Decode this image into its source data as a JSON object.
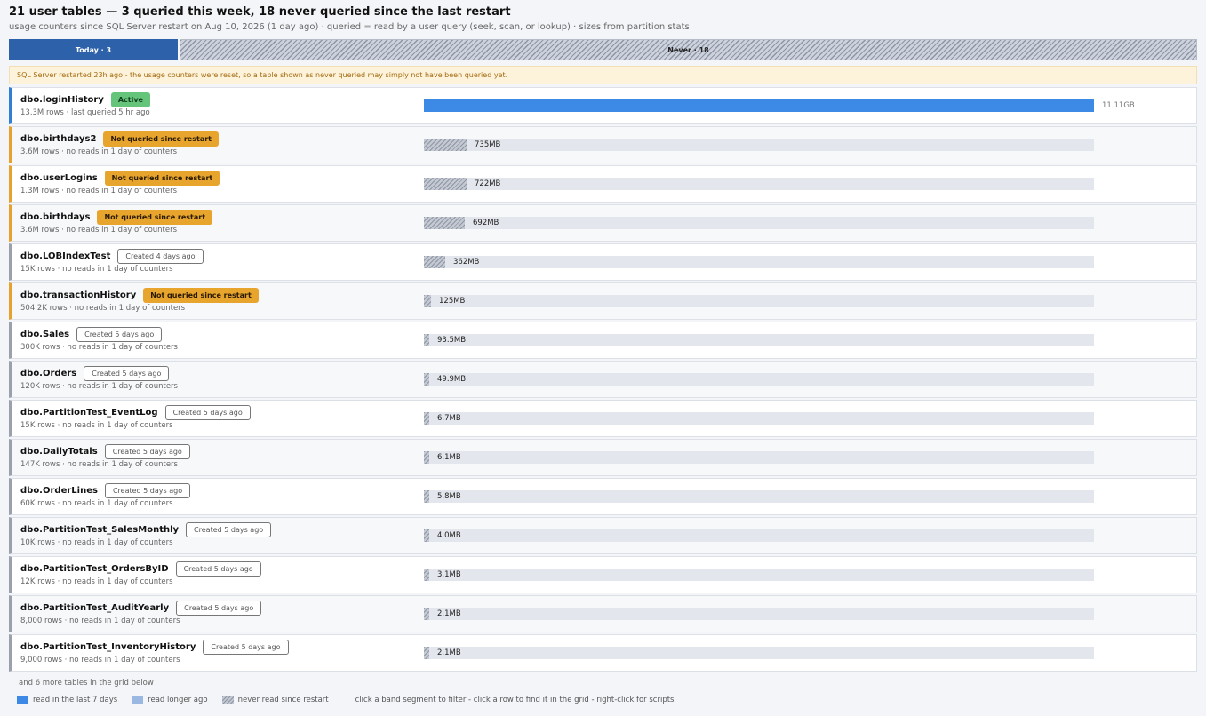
{
  "header": {
    "title": "21 user tables — 3 queried this week, 18 never queried since the last restart",
    "subtitle": "usage counters since SQL Server restart on Aug 10, 2026 (1 day ago)   ·   queried = read by a user query (seek, scan, or lookup)   ·   sizes from partition stats"
  },
  "band": {
    "today_label": "Today · 3",
    "never_label": "Never · 18"
  },
  "warning": "SQL Server restarted 23h ago - the usage counters were reset, so a table shown as never queried may simply not have been queried yet.",
  "rows": [
    {
      "name": "dbo.loginHistory",
      "badge": "Active",
      "status": "active",
      "meta": "13.3M rows · last queried 5 hr ago",
      "size": "11.11GB",
      "fraction": 1.0
    },
    {
      "name": "dbo.birthdays2",
      "badge": "Not queried since restart",
      "status": "never",
      "meta": "3.6M rows · no reads in 1 day of counters",
      "size": "735MB",
      "fraction": 0.064
    },
    {
      "name": "dbo.userLogins",
      "badge": "Not queried since restart",
      "status": "never",
      "meta": "1.3M rows · no reads in 1 day of counters",
      "size": "722MB",
      "fraction": 0.063
    },
    {
      "name": "dbo.birthdays",
      "badge": "Not queried since restart",
      "status": "never",
      "meta": "3.6M rows · no reads in 1 day of counters",
      "size": "692MB",
      "fraction": 0.061
    },
    {
      "name": "dbo.LOBIndexTest",
      "badge": "Created 4 days ago",
      "status": "created",
      "meta": "15K rows · no reads in 1 day of counters",
      "size": "362MB",
      "fraction": 0.032
    },
    {
      "name": "dbo.transactionHistory",
      "badge": "Not queried since restart",
      "status": "never",
      "meta": "504.2K rows · no reads in 1 day of counters",
      "size": "125MB",
      "fraction": 0.011
    },
    {
      "name": "dbo.Sales",
      "badge": "Created 5 days ago",
      "status": "created",
      "meta": "300K rows · no reads in 1 day of counters",
      "size": "93.5MB",
      "fraction": 0.008
    },
    {
      "name": "dbo.Orders",
      "badge": "Created 5 days ago",
      "status": "created",
      "meta": "120K rows · no reads in 1 day of counters",
      "size": "49.9MB",
      "fraction": 0.004
    },
    {
      "name": "dbo.PartitionTest_EventLog",
      "badge": "Created 5 days ago",
      "status": "created",
      "meta": "15K rows · no reads in 1 day of counters",
      "size": "6.7MB",
      "fraction": 0.0006
    },
    {
      "name": "dbo.DailyTotals",
      "badge": "Created 5 days ago",
      "status": "created",
      "meta": "147K rows · no reads in 1 day of counters",
      "size": "6.1MB",
      "fraction": 0.0005
    },
    {
      "name": "dbo.OrderLines",
      "badge": "Created 5 days ago",
      "status": "created",
      "meta": "60K rows · no reads in 1 day of counters",
      "size": "5.8MB",
      "fraction": 0.0005
    },
    {
      "name": "dbo.PartitionTest_SalesMonthly",
      "badge": "Created 5 days ago",
      "status": "created",
      "meta": "10K rows · no reads in 1 day of counters",
      "size": "4.0MB",
      "fraction": 0.0004
    },
    {
      "name": "dbo.PartitionTest_OrdersByID",
      "badge": "Created 5 days ago",
      "status": "created",
      "meta": "12K rows · no reads in 1 day of counters",
      "size": "3.1MB",
      "fraction": 0.0003
    },
    {
      "name": "dbo.PartitionTest_AuditYearly",
      "badge": "Created 5 days ago",
      "status": "created",
      "meta": "8,000 rows · no reads in 1 day of counters",
      "size": "2.1MB",
      "fraction": 0.0002
    },
    {
      "name": "dbo.PartitionTest_InventoryHistory",
      "badge": "Created 5 days ago",
      "status": "created",
      "meta": "9,000 rows · no reads in 1 day of counters",
      "size": "2.1MB",
      "fraction": 0.0002
    }
  ],
  "footer": {
    "more": "and 6 more tables in the grid below",
    "legend": [
      "read in the last 7 days",
      "read longer ago",
      "never read since restart"
    ],
    "hint": "click a band segment to filter - click a row to find it in the grid - right-click for scripts"
  }
}
